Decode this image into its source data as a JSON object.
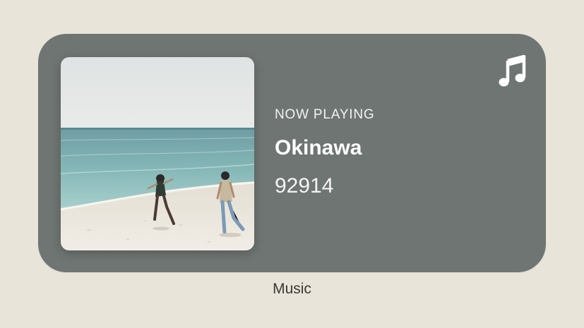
{
  "widget": {
    "label": "Music",
    "background_color": "#6e7572",
    "app_icon": "music-note-icon",
    "artwork": "album-artwork-beach-photo",
    "now_playing_label": "NOW PLAYING",
    "track_title": "Okinawa",
    "artist": "92914"
  },
  "page": {
    "background_color": "#e8e4da"
  }
}
